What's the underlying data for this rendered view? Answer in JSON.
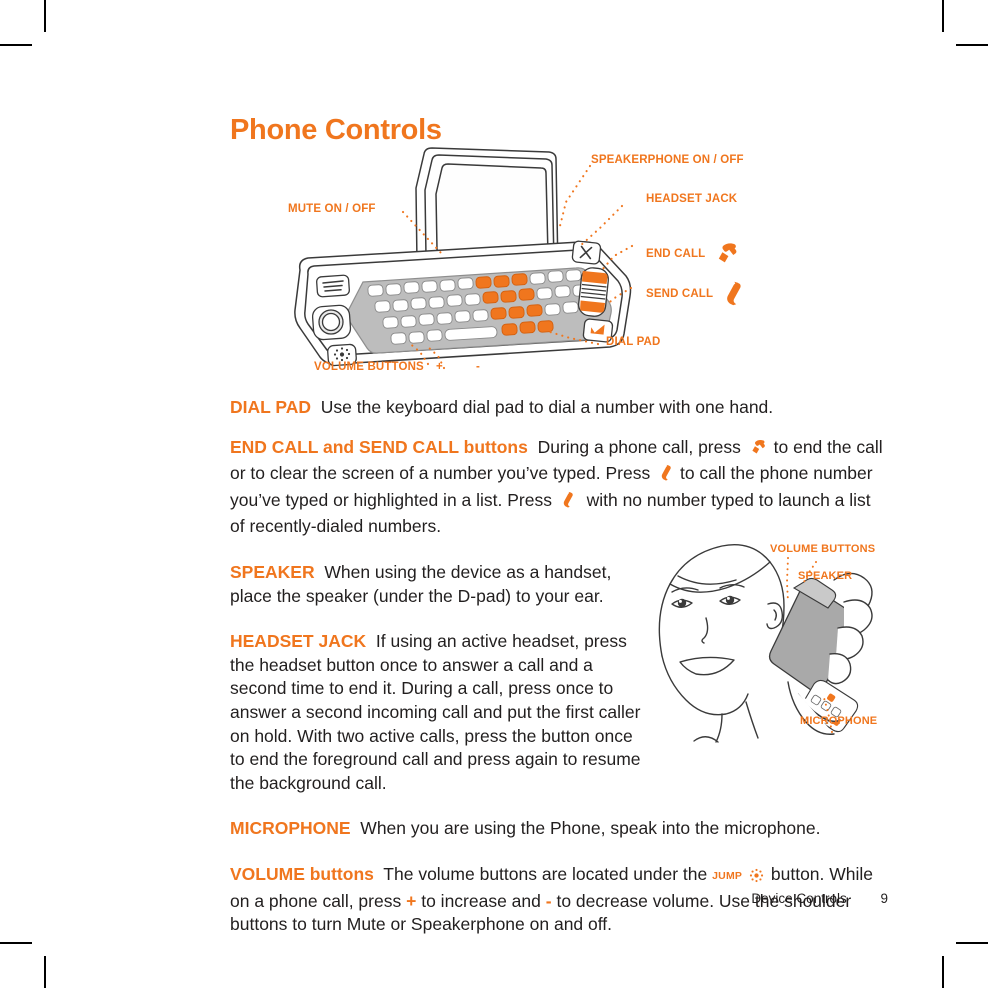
{
  "page": {
    "title": "Phone Controls",
    "footer_section": "Device Controls",
    "footer_page_number": "9"
  },
  "colors": {
    "accent_orange": "#f0761e",
    "body_text": "#221f1f",
    "keyboard_gray": "#b9b9b9",
    "line_art": "#3a3a3a"
  },
  "diagram": {
    "alt": "qwerty-slider-phone-line-drawing",
    "callouts": [
      {
        "name": "speakerphone",
        "label": "SPEAKERPHONE ON / OFF",
        "icon": null
      },
      {
        "name": "headset-jack",
        "label": "HEADSET JACK",
        "icon": null
      },
      {
        "name": "end-call",
        "label": "END CALL",
        "icon": "end-call-handset-icon"
      },
      {
        "name": "send-call",
        "label": "SEND CALL",
        "icon": "send-call-handset-icon"
      },
      {
        "name": "dial-pad",
        "label": "DIAL PAD",
        "icon": null
      },
      {
        "name": "mute",
        "label": "MUTE ON / OFF",
        "icon": null
      },
      {
        "name": "volume-buttons",
        "label": "VOLUME BUTTONS",
        "icon": null
      },
      {
        "name": "volume-plus",
        "label": "+",
        "icon": null
      },
      {
        "name": "volume-minus",
        "label": "-",
        "icon": null
      }
    ]
  },
  "sections": {
    "dial_pad": {
      "lead": "DIAL PAD",
      "text": "Use the keyboard dial pad to dial a number with one hand."
    },
    "end_send_call": {
      "lead": "END CALL and SEND CALL buttons",
      "text_1": "During a phone call, press",
      "text_2": "to end the call or to clear the screen of a number you’ve typed. Press",
      "text_3": "to call the phone number you’ve typed or highlighted in a list. Press",
      "text_4": "with no number typed to launch a list of recently-dialed numbers."
    },
    "speaker": {
      "lead": "SPEAKER",
      "text": "When using the device as a handset, place the speaker (under the D-pad) to your ear."
    },
    "headset_jack": {
      "lead": "HEADSET JACK",
      "text": "If using an active headset, press the headset button once to answer a call and a second time to end it. During a call, press once to answer a second incoming call and put the first caller on hold. With two active calls, press the button once to end the foreground call and press again to resume the background call."
    },
    "microphone": {
      "lead": "MICROPHONE",
      "text": "When you are using the Phone, speak into the microphone."
    },
    "volume": {
      "lead": "VOLUME buttons",
      "text_1": "The volume buttons are located under the",
      "jump_label": "JUMP",
      "text_2": "button. While on a phone call, press",
      "plus": "+",
      "text_3": "to increase and",
      "minus": "-",
      "text_4": "to decrease volume. Use the shoulder buttons to turn Mute or Speakerphone on and off."
    }
  },
  "illustration": {
    "alt": "woman-holding-phone-to-ear-line-drawing",
    "labels": [
      {
        "name": "volume-buttons",
        "label": "VOLUME BUTTONS"
      },
      {
        "name": "speaker",
        "label": "SPEAKER"
      },
      {
        "name": "microphone",
        "label": "MICROPHONE"
      }
    ]
  }
}
